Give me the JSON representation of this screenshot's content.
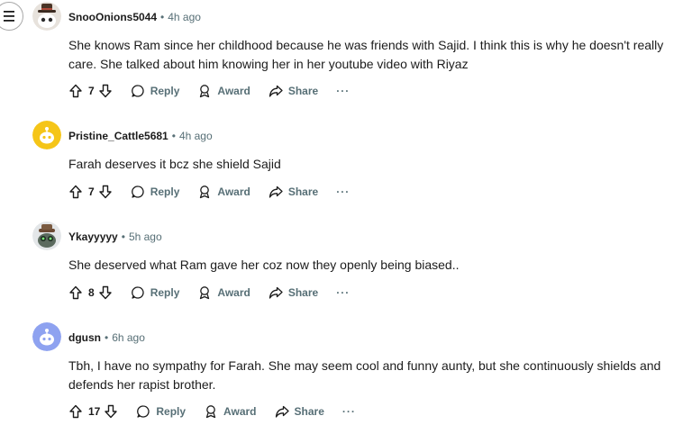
{
  "comments": [
    {
      "username": "SnooOnions5044",
      "time": "4h ago",
      "body": "She knows Ram since her childhood because he was friends with Sajid. I think this is why he doesn't really care. She talked about him knowing her in her youtube video with Riyaz",
      "votes": "7",
      "avatar": "snoo-hat-avatar"
    },
    {
      "username": "Pristine_Cattle5681",
      "time": "4h ago",
      "body": "Farah deserves it bcz she shield Sajid",
      "votes": "7",
      "avatar": "snoo-yellow-avatar"
    },
    {
      "username": "Ykayyyyy",
      "time": "5h ago",
      "body": "She deserved what Ram gave her coz now they openly being biased..",
      "votes": "8",
      "avatar": "snoo-goggles-avatar"
    },
    {
      "username": "dgusn",
      "time": "6h ago",
      "body": "Tbh, I have no sympathy for Farah. She may seem cool and funny aunty, but she continuously shields and defends her rapist brother.",
      "votes": "17",
      "avatar": "snoo-blue-avatar"
    }
  ],
  "actions": {
    "reply": "Reply",
    "award": "Award",
    "share": "Share",
    "more": "···"
  },
  "colors": {
    "meta": "#576f76",
    "text": "#1c1c1c",
    "yellow_avatar": "#f5c518",
    "blue_avatar": "#8ea2f0"
  }
}
